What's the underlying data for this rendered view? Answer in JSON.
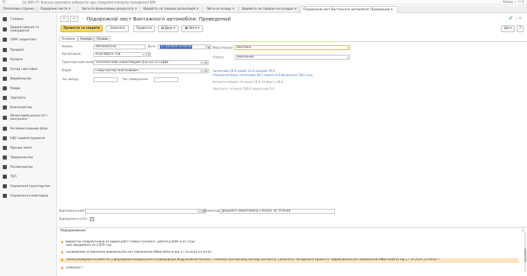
{
  "titlebar": {
    "logo": "1С",
    "text": "(1С:ERP) УТ: Business automation software for agro. Integrated enterprise management ERP",
    "right": "Акорд  —  ☐  ✕"
  },
  "tabs": [
    "Початкова сторінка",
    "Подорожні листи ✕",
    "Звіти по фінансовому результату ✕",
    "Відомість по товарах організацій ✕",
    "Звіти по складу ✕",
    "Відомість по товарах на складах ✕",
    "Подорожній лист Вантажного автомобіля: Проведений ✕"
  ],
  "sidebar": [
    "Головне",
    "Бюджетування та планування",
    "CRM і маркетинг",
    "Продажі",
    "Купівля",
    "Склад і доставка",
    "Виробництво",
    "Кадри",
    "Зарплата",
    "Казначейство",
    "Фінансовий результат і контролінг",
    "Регламентований облік",
    "НДІ і адміністрування",
    "Оренда землі",
    "Тваринництво",
    "Рослинництво",
    "ТЕП",
    "Управління транспортом",
    "Управління елеватором"
  ],
  "header": {
    "back": "←",
    "forward": "→",
    "star": "☆",
    "title": "Подорожній лист Вантажного автомобіля: Проведений",
    "actions": "🔗  ⋮  ✕"
  },
  "toolbar": {
    "post_close": "Провести та закрити",
    "save": "Записати",
    "post": "Провести",
    "print": "Друк",
    "report": "Звіти",
    "more": "Ще"
  },
  "form_tabs": [
    "Основне",
    "Наряди",
    "Паливо"
  ],
  "fields": {
    "number_label": "Номер:",
    "number": "АФ-00000158",
    "date_label": "Дата:",
    "date": "17.10.2024 23:59:02",
    "org_label": "Організація:",
    "org": "Агро-Форте ТОВ",
    "vehicle_label": "Транспортний засіб:",
    "vehicle": "Телескопічний навантажувач JCB 535 3773BBX",
    "driver_label": "Водій:",
    "driver": "Сквірн Віктор Анатолійович",
    "depart_label": "Час виїзду:",
    "depart": ":",
    "return_label": "Час повернення:",
    "return": ":",
    "optype_label": "Вид операції:",
    "optype": "Вантажні",
    "status_label": "Статус:",
    "status": "Виконаний"
  },
  "info": {
    "line1": "початкова 59,0 пробіг 11,6 кінцева 70,6",
    "line2": "Показання бака: початкова 58,1 залито 0,0 витрачено 28,6 кінц.",
    "fuel": "Витрата палива: по нормі 28,6 по факту 28,6",
    "salary": "Зарплата: основна 200,0 додаткова 0,0"
  },
  "bottom": {
    "resp_label": "Відповідальний:",
    "comment_label": "Коментар:",
    "comment": "Документ завантажено з Ifconio. ID: #16196",
    "reflect_label": "Відобразити в БО:"
  },
  "messages": {
    "title": "Повідомлення:",
    "items": [
      "Виробіток співробітників за видом робіт: Навант-розвант. роботи JCB/МТЗ/ЗП (год)\nаже оформлено на 1,876 год",
      "Проведений не виконане Виробництво без замовлення АФ60-000014 від 17.10.2024 23:59:02",
      "{ВнешняОбработка.ИНАГРО_СформированныйДокументыЗаводовный.МодульОбъекта(304)}: Помилка при виклику методу контексту (Записать): Не вдалося провести \"Виробництво без замовлення АФ60-000014 від 17.10.2024 23:59:02\"!",
      "Помилка!!!"
    ]
  }
}
